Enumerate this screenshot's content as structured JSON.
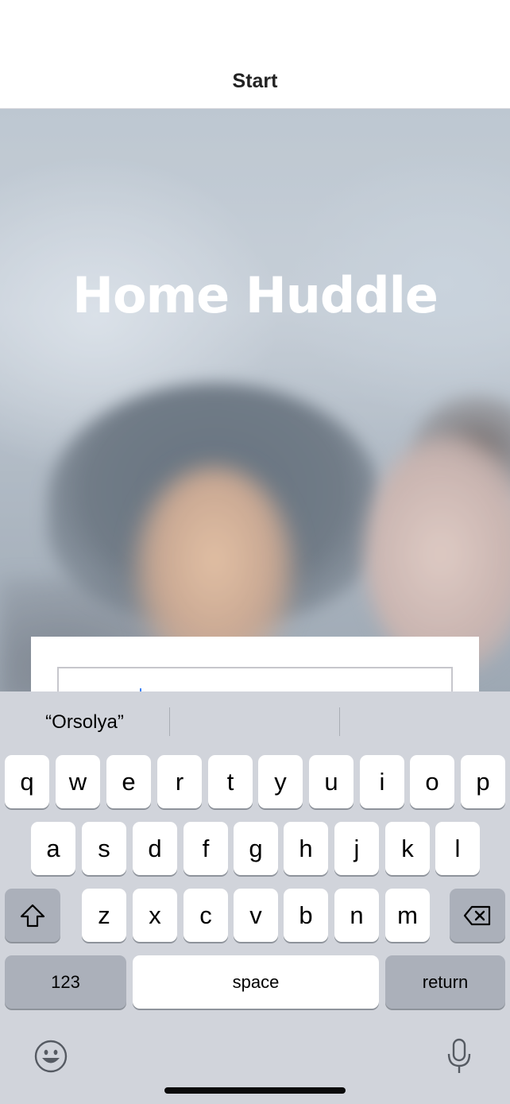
{
  "nav": {
    "title": "Start"
  },
  "hero": {
    "title": "Home Huddle"
  },
  "form": {
    "name_input_value": ""
  },
  "keyboard": {
    "suggestions": [
      "“Orsolya”",
      "",
      ""
    ],
    "row1": [
      "q",
      "w",
      "e",
      "r",
      "t",
      "y",
      "u",
      "i",
      "o",
      "p"
    ],
    "row2": [
      "a",
      "s",
      "d",
      "f",
      "g",
      "h",
      "j",
      "k",
      "l"
    ],
    "row3": [
      "z",
      "x",
      "c",
      "v",
      "b",
      "n",
      "m"
    ],
    "numbers_label": "123",
    "space_label": "space",
    "return_label": "return",
    "icons": {
      "shift": "shift-icon",
      "delete": "backspace-icon",
      "emoji": "emoji-icon",
      "dictation": "microphone-icon"
    }
  },
  "colors": {
    "keyboard_background": "#d1d4db",
    "key_background": "#ffffff",
    "function_key_background": "#abb0ba",
    "hero_title": "#ffffff",
    "caret": "#3b82f6"
  }
}
